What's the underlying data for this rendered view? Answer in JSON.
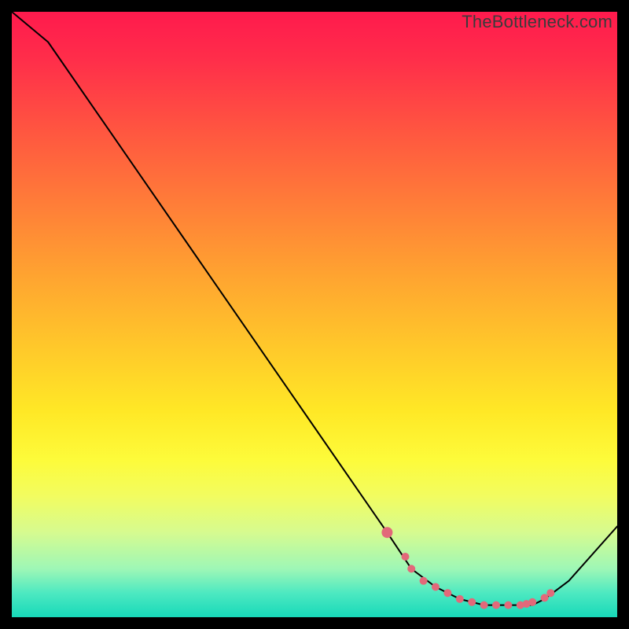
{
  "watermark": "TheBottleneck.com",
  "chart_data": {
    "type": "line",
    "title": "",
    "xlabel": "",
    "ylabel": "",
    "xlim": [
      0,
      100
    ],
    "ylim": [
      0,
      100
    ],
    "series": [
      {
        "name": "bottleneck-curve",
        "x": [
          0,
          6,
          62,
          66,
          70,
          74,
          78,
          82,
          86,
          88,
          92,
          100
        ],
        "values": [
          100,
          95,
          14,
          8,
          5,
          3,
          2,
          2,
          2,
          3,
          6,
          15
        ]
      }
    ],
    "markers": {
      "name": "optimal-range",
      "color": "#e2697a",
      "points_x": [
        62,
        65,
        66,
        68,
        70,
        72,
        74,
        76,
        78,
        80,
        82,
        84,
        85,
        86,
        88,
        89
      ],
      "points_y": [
        14,
        10,
        8,
        6,
        5,
        4,
        3,
        2.5,
        2,
        2,
        2,
        2,
        2.2,
        2.5,
        3.2,
        4
      ]
    }
  }
}
